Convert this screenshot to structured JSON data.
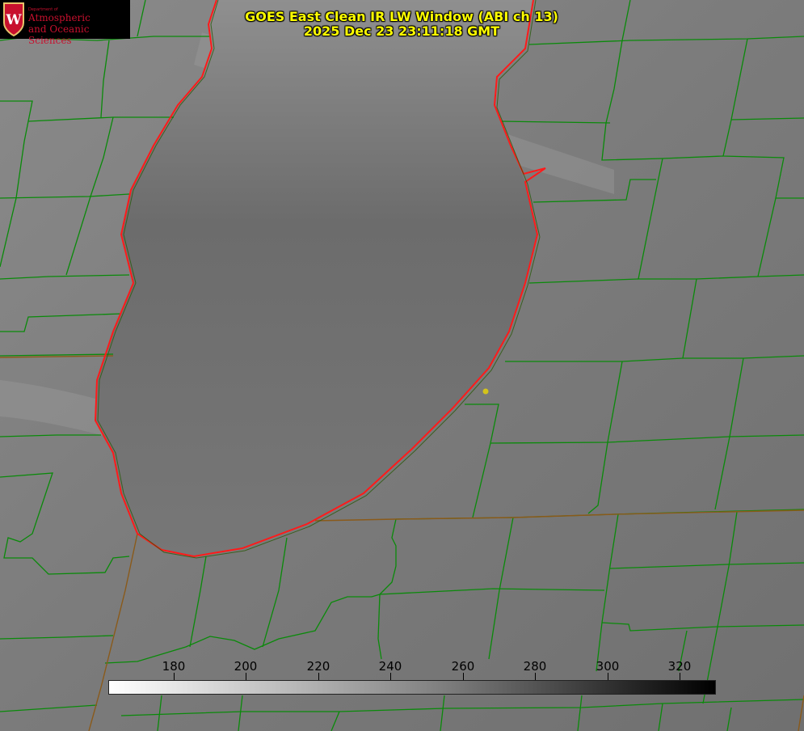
{
  "header": {
    "title_line1": "GOES East Clean IR LW Window (ABI ch 13)",
    "title_line2": "2025 Dec 23 23:11:18 GMT"
  },
  "logo": {
    "department": "Department of",
    "name_line1": "Atmospheric",
    "name_line2": "and Oceanic Sciences",
    "icon": "uw-crest-icon"
  },
  "colorbar": {
    "ticks": [
      "180",
      "200",
      "220",
      "240",
      "260",
      "280",
      "300",
      "320"
    ],
    "colors": {
      "low": "#ffffff",
      "high": "#000000"
    }
  },
  "colors": {
    "county_lines": "#0a8a0a",
    "lake_outline": "#ff1a1a",
    "title_text": "#ffff00",
    "marker": "#d4c41a"
  }
}
